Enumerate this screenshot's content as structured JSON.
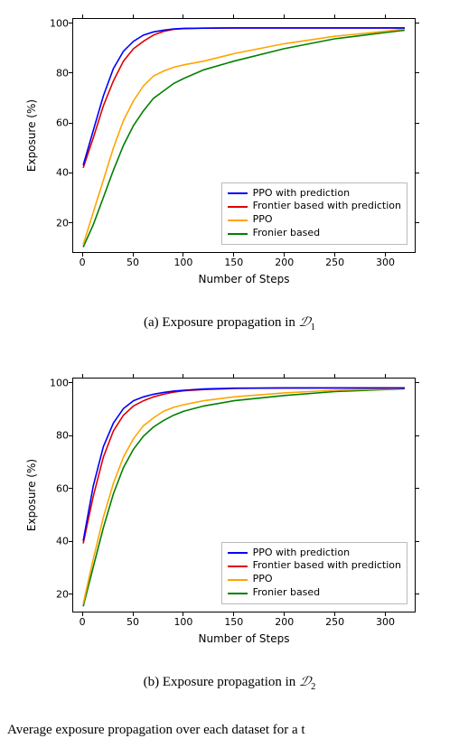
{
  "chart_data": [
    {
      "id": "d1",
      "type": "line",
      "title": "",
      "xlabel": "Number of Steps",
      "ylabel": "Exposure (%)",
      "xlim": [
        -10,
        330
      ],
      "ylim": [
        8,
        102
      ],
      "xticks": [
        0,
        50,
        100,
        150,
        200,
        250,
        300
      ],
      "yticks": [
        20,
        40,
        60,
        80,
        100
      ],
      "series": [
        {
          "name": "PPO with prediction",
          "color": "#0000ff",
          "x": [
            0,
            10,
            20,
            30,
            40,
            50,
            60,
            70,
            80,
            90,
            100,
            120,
            150,
            200,
            250,
            300,
            320
          ],
          "y": [
            43,
            57,
            71,
            82,
            89,
            93,
            95.5,
            96.8,
            97.5,
            98,
            98.2,
            98.3,
            98.4,
            98.4,
            98.4,
            98.4,
            98.4
          ]
        },
        {
          "name": "Frontier based with prediction",
          "color": "#e00000",
          "x": [
            0,
            10,
            20,
            30,
            40,
            50,
            60,
            70,
            80,
            90,
            100,
            120,
            150,
            200,
            250,
            300,
            320
          ],
          "y": [
            42,
            54,
            67,
            77,
            85,
            90,
            93,
            95.5,
            97,
            97.8,
            98.1,
            98.3,
            98.4,
            98.4,
            98.4,
            98.4,
            98.4
          ]
        },
        {
          "name": "PPO",
          "color": "#ffa500",
          "x": [
            0,
            10,
            20,
            30,
            40,
            50,
            60,
            70,
            80,
            90,
            100,
            120,
            150,
            200,
            250,
            300,
            320
          ],
          "y": [
            11,
            24,
            37,
            50,
            61,
            69,
            75,
            79,
            81,
            82.5,
            83.5,
            85,
            88,
            92,
            95,
            97,
            98
          ]
        },
        {
          "name": "Fronier based",
          "color": "#008000",
          "x": [
            0,
            10,
            20,
            30,
            40,
            50,
            60,
            70,
            80,
            90,
            100,
            120,
            150,
            200,
            250,
            300,
            320
          ],
          "y": [
            10,
            19,
            30,
            41,
            51,
            59,
            65,
            70,
            73,
            76,
            78,
            81.5,
            85,
            90,
            94,
            96.5,
            97.5
          ]
        }
      ],
      "caption_prefix": "(a) Exposure propagation in ",
      "caption_symbol": "𝒟",
      "caption_sub": "1"
    },
    {
      "id": "d2",
      "type": "line",
      "title": "",
      "xlabel": "Number of Steps",
      "ylabel": "Exposure (%)",
      "xlim": [
        -10,
        330
      ],
      "ylim": [
        13,
        102
      ],
      "xticks": [
        0,
        50,
        100,
        150,
        200,
        250,
        300
      ],
      "yticks": [
        20,
        40,
        60,
        80,
        100
      ],
      "series": [
        {
          "name": "PPO with prediction",
          "color": "#0000ff",
          "x": [
            0,
            10,
            20,
            30,
            40,
            50,
            60,
            70,
            80,
            90,
            100,
            120,
            150,
            200,
            250,
            300,
            320
          ],
          "y": [
            40,
            61,
            76,
            85,
            90.5,
            93.5,
            95,
            96,
            96.7,
            97.2,
            97.5,
            98,
            98.3,
            98.4,
            98.4,
            98.4,
            98.4
          ]
        },
        {
          "name": "Frontier based with prediction",
          "color": "#e00000",
          "x": [
            0,
            10,
            20,
            30,
            40,
            50,
            60,
            70,
            80,
            90,
            100,
            120,
            150,
            200,
            250,
            300,
            320
          ],
          "y": [
            39,
            57,
            72,
            82,
            88,
            91.5,
            93.5,
            95,
            96,
            96.8,
            97.3,
            97.8,
            98.2,
            98.4,
            98.4,
            98.4,
            98.4
          ]
        },
        {
          "name": "PPO",
          "color": "#ffa500",
          "x": [
            0,
            10,
            20,
            30,
            40,
            50,
            60,
            70,
            80,
            90,
            100,
            120,
            150,
            200,
            250,
            300,
            320
          ],
          "y": [
            16,
            33,
            49,
            62,
            72,
            79,
            84,
            87,
            89.5,
            91,
            92,
            93.5,
            95,
            96.5,
            97.5,
            98,
            98.3
          ]
        },
        {
          "name": "Fronier based",
          "color": "#008000",
          "x": [
            0,
            10,
            20,
            30,
            40,
            50,
            60,
            70,
            80,
            90,
            100,
            120,
            150,
            200,
            250,
            300,
            320
          ],
          "y": [
            15,
            30,
            45,
            58,
            68,
            75,
            80,
            83.5,
            86,
            88,
            89.5,
            91.5,
            93.5,
            95.5,
            97,
            97.8,
            98.1
          ]
        }
      ],
      "caption_prefix": "(b) Exposure propagation in ",
      "caption_symbol": "𝒟",
      "caption_sub": "2"
    }
  ],
  "legend_labels": {
    "s0": "PPO with prediction",
    "s1": "Frontier based with prediction",
    "s2": "PPO",
    "s3": "Fronier based"
  },
  "bottom_text": "Average exposure propagation over each dataset for a t"
}
